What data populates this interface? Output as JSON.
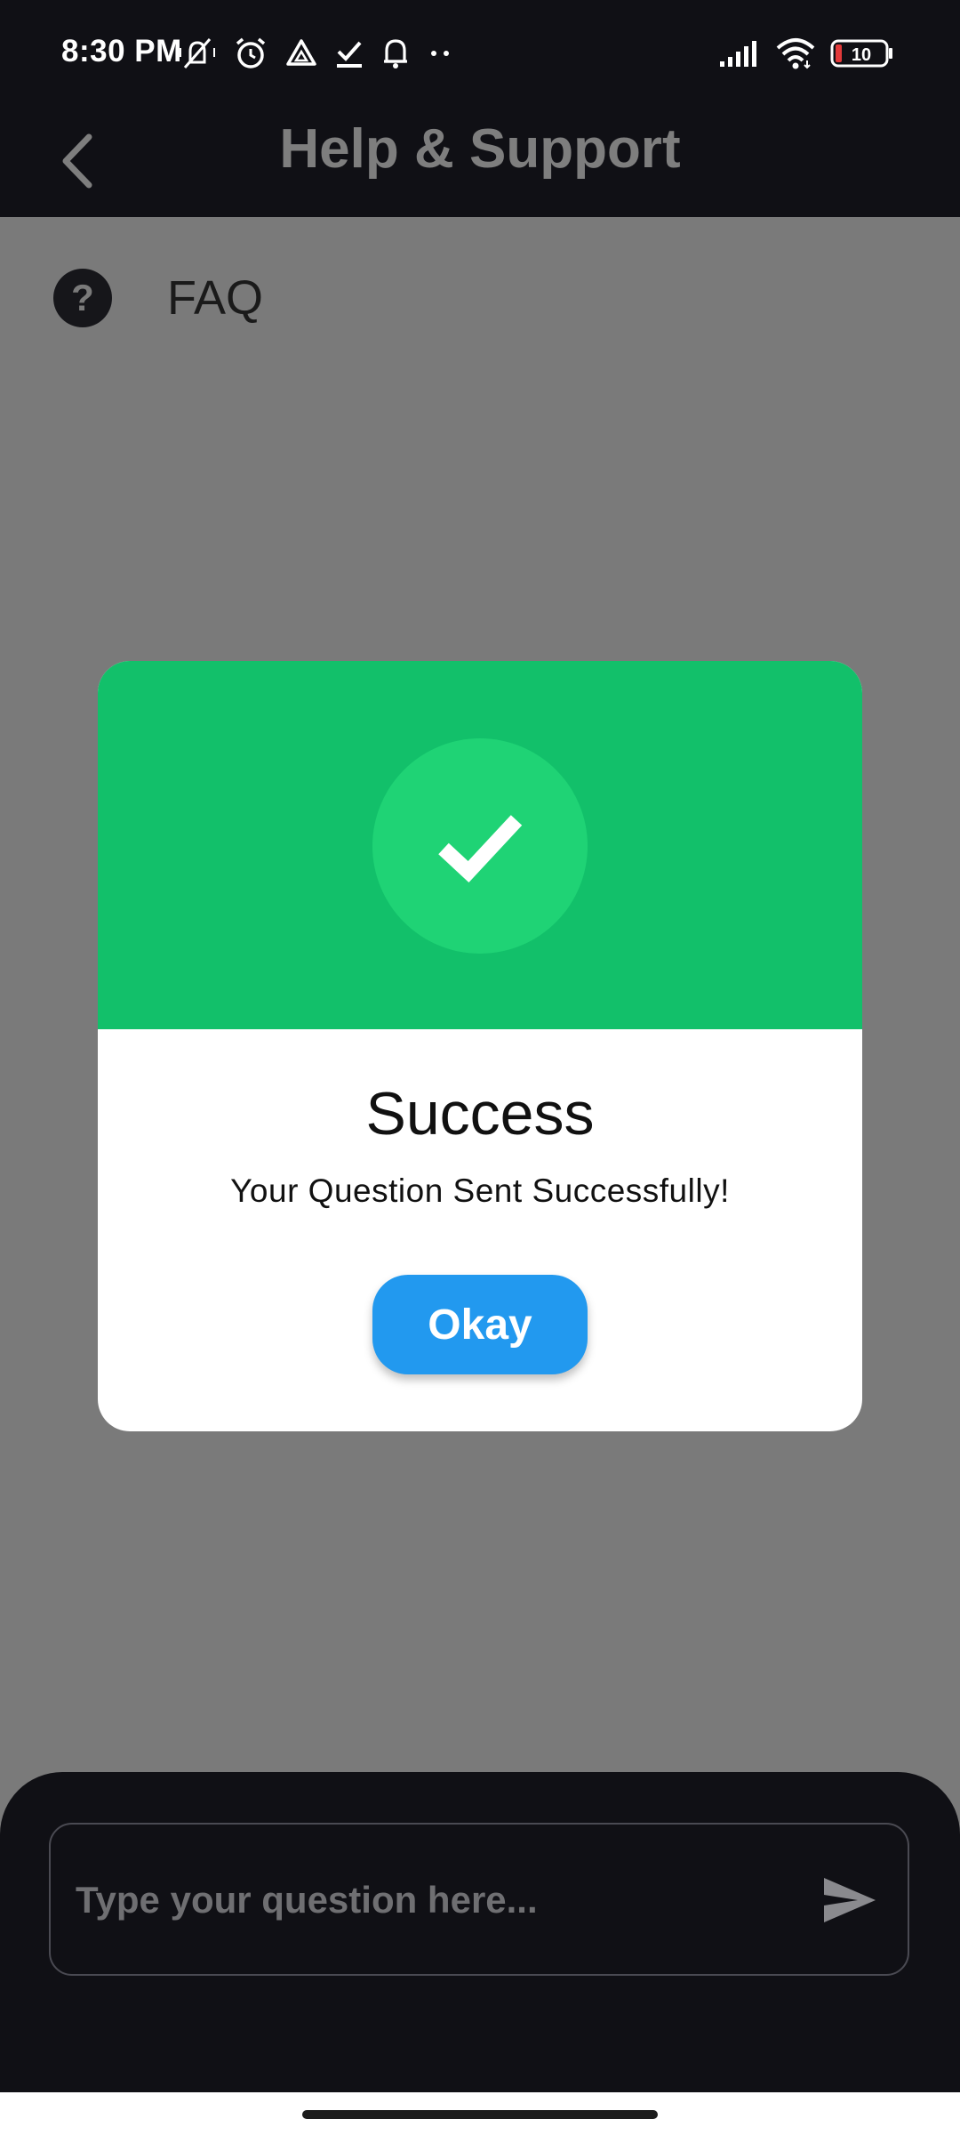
{
  "status_bar": {
    "time": "8:30 PM",
    "left_icons": [
      "mute-icon",
      "alarm-icon",
      "drive-icon",
      "check-icon",
      "bell-icon",
      "more-dots-icon"
    ],
    "right_icons": [
      "signal-icon",
      "wifi-icon",
      "battery-icon"
    ],
    "battery_level": "10"
  },
  "app_bar": {
    "title": "Help & Support"
  },
  "faq": {
    "icon_glyph": "?",
    "label": "FAQ"
  },
  "dialog": {
    "title": "Success",
    "message": "Your Question Sent Successfully!",
    "okay_label": "Okay",
    "header_color": "#12c06a"
  },
  "question_input": {
    "value": "",
    "placeholder": "Type your question here..."
  },
  "colors": {
    "accent": "#2299ef",
    "success": "#12c06a",
    "dark": "#101015"
  }
}
